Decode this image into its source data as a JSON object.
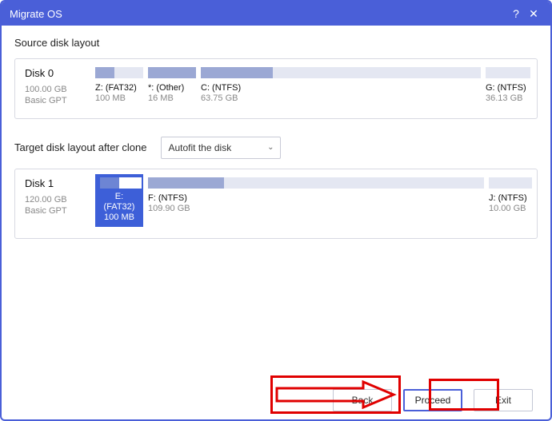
{
  "window": {
    "title": "Migrate OS",
    "help_glyph": "?",
    "close_glyph": "✕"
  },
  "source": {
    "section_label": "Source disk layout",
    "disk": {
      "name": "Disk 0",
      "size": "100.00 GB",
      "type": "Basic GPT"
    },
    "partitions": [
      {
        "label": "Z: (FAT32)",
        "size": "100 MB"
      },
      {
        "label": "*: (Other)",
        "size": "16 MB"
      },
      {
        "label": "C: (NTFS)",
        "size": "63.75 GB"
      },
      {
        "label": "G: (NTFS)",
        "size": "36.13 GB"
      }
    ]
  },
  "target": {
    "section_label": "Target disk layout after clone",
    "dropdown": {
      "value": "Autofit the disk"
    },
    "disk": {
      "name": "Disk 1",
      "size": "120.00 GB",
      "type": "Basic GPT"
    },
    "partitions": [
      {
        "label": "E: (FAT32)",
        "size": "100 MB"
      },
      {
        "label": "F: (NTFS)",
        "size": "109.90 GB"
      },
      {
        "label": "J: (NTFS)",
        "size": "10.00 GB"
      }
    ]
  },
  "footer": {
    "back": "Back",
    "proceed": "Proceed",
    "exit": "Exit"
  }
}
